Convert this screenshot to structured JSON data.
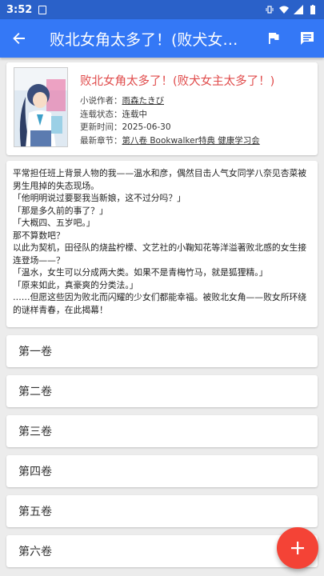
{
  "status_bar": {
    "time": "3:52"
  },
  "app_bar": {
    "title": "败北女角太多了！(败犬女主太多了！)"
  },
  "book": {
    "title": "败北女角太多了！(败犬女主太多了！)",
    "author_label": "小说作者：",
    "author": "雨森たきび",
    "status_label": "连载状态：",
    "status": "连载中",
    "updated_label": "更新时间：",
    "updated": "2025-06-30",
    "latest_label": "最新章节：",
    "latest": "第八卷 Bookwalker特典 健康学习会"
  },
  "intro": [
    "平常担任班上背景人物的我——温水和彦，偶然目击人气女同学八奈见杏菜被男生甩掉的失态现场。",
    "「他明明说过要娶我当新娘，这不过分吗？」",
    "「那是多久前的事了？」",
    "「大概四、五岁吧。」",
    "那不算数吧？",
    "以此为契机，田径队的烧盐柠檬、文艺社的小鞠知花等洋溢著败北感的女生接连登场——？",
    "「温水，女生可以分成两大类。如果不是青梅竹马，就是狐狸精。」",
    "「原来如此，真豪爽的分类法。」",
    "……但愿这些因为败北而闪耀的少女们都能幸福。被败北女角——败女所环绕的谜样青春，在此揭幕！"
  ],
  "volumes": [
    "第一卷",
    "第二卷",
    "第三卷",
    "第四卷",
    "第五卷",
    "第六卷"
  ],
  "colors": {
    "appbar": "#3478f6",
    "statusbar": "#2a61c9",
    "title_red": "#e04b4b",
    "fab": "#f44336"
  },
  "icons": {
    "back": "arrow-left-icon",
    "flag": "flag-icon",
    "comment": "comment-icon",
    "fab": "plus-icon"
  }
}
